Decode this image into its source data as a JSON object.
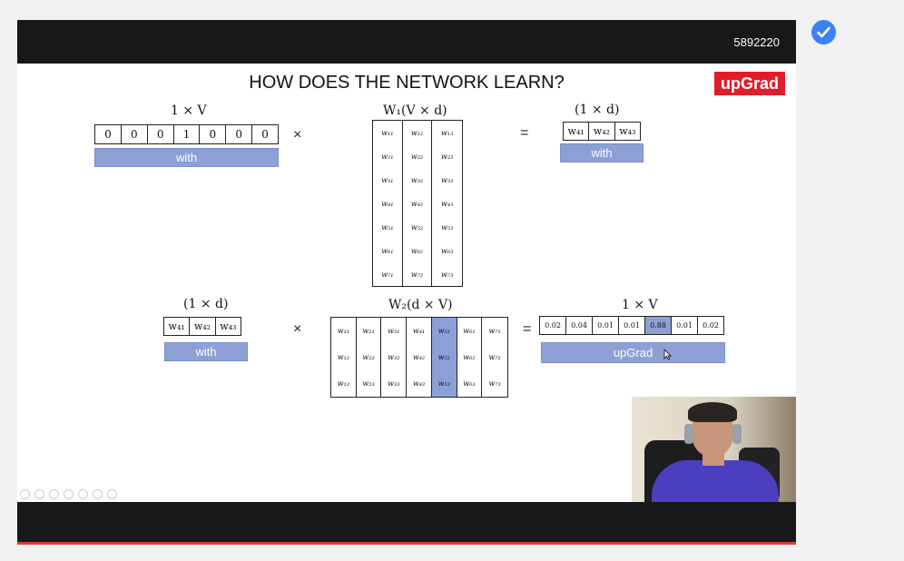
{
  "session_id": "5892220",
  "slide": {
    "title": "HOW DOES THE NETWORK LEARN?",
    "logo": "upGrad",
    "top": {
      "label_left": "1 × V",
      "onehot": [
        "0",
        "0",
        "0",
        "1",
        "0",
        "0",
        "0"
      ],
      "bar_left": "with",
      "times": "×",
      "label_w1": "W₁(V × d)",
      "w1": [
        [
          "w₁₁",
          "w₁₂",
          "w₁₃"
        ],
        [
          "w₂₁",
          "w₂₂",
          "w₂₃"
        ],
        [
          "w₃₁",
          "w₃₂",
          "w₃₃"
        ],
        [
          "w₄₁",
          "w₄₂",
          "w₄₃"
        ],
        [
          "w₅₁",
          "w₅₂",
          "w₅₃"
        ],
        [
          "w₆₁",
          "w₆₂",
          "w₆₃"
        ],
        [
          "w₇₁",
          "w₇₂",
          "w₇₃"
        ]
      ],
      "equals": "=",
      "label_right": "(1 × d)",
      "result": [
        "w₄₁",
        "w₄₂",
        "w₄₃"
      ],
      "bar_right": "with"
    },
    "bottom": {
      "label_left": "(1 × d)",
      "vector": [
        "w₄₁",
        "w₄₂",
        "w₄₃"
      ],
      "bar_left": "with",
      "times": "×",
      "label_w2": "W₂(d × V)",
      "w2": [
        [
          "w₁₁",
          "w₂₁",
          "w₃₁",
          "w₄₁",
          "w₅₁",
          "w₆₁",
          "w₇₁"
        ],
        [
          "w₁₂",
          "w₂₂",
          "w₃₂",
          "w₄₂",
          "w₅₂",
          "w₆₂",
          "w₇₂"
        ],
        [
          "w₁₃",
          "w₂₃",
          "w₃₃",
          "w₄₃",
          "w₅₃",
          "w₆₃",
          "w₇₃"
        ]
      ],
      "w2_highlight_col": 4,
      "equals": "=",
      "label_right": "1 × V",
      "probs": [
        "0.02",
        "0.04",
        "0.01",
        "0.01",
        "0.88",
        "0.01",
        "0.02"
      ],
      "probs_highlight": 4,
      "bar_right": "upGrad"
    }
  },
  "colors": {
    "highlight": "#8da0d6",
    "brand": "#e11d2b",
    "check": "#3b82f6"
  }
}
